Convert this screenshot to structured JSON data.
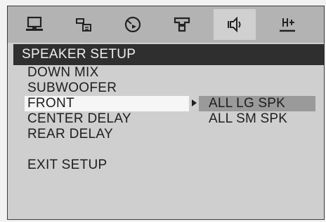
{
  "toolbar": {
    "icons": [
      {
        "name": "general-setup-icon"
      },
      {
        "name": "language-setup-icon"
      },
      {
        "name": "video-setup-icon"
      },
      {
        "name": "audio-setup-icon"
      },
      {
        "name": "speaker-setup-icon",
        "active": true
      },
      {
        "name": "preferences-icon"
      }
    ]
  },
  "title": "SPEAKER SETUP",
  "menu": {
    "items": [
      {
        "label": "DOWN MIX"
      },
      {
        "label": "SUBWOOFER"
      },
      {
        "label": "FRONT",
        "selected": true
      },
      {
        "label": "CENTER DELAY"
      },
      {
        "label": "REAR DELAY"
      },
      {
        "label": "EXIT SETUP"
      }
    ]
  },
  "submenu": {
    "options": [
      {
        "label": "ALL LG SPK",
        "highlighted": true
      },
      {
        "label": "ALL SM SPK"
      }
    ]
  },
  "colors": {
    "panel": "#cfcfcf",
    "title_bar": "#2f2f2f",
    "highlight": "#9a9a9a"
  }
}
